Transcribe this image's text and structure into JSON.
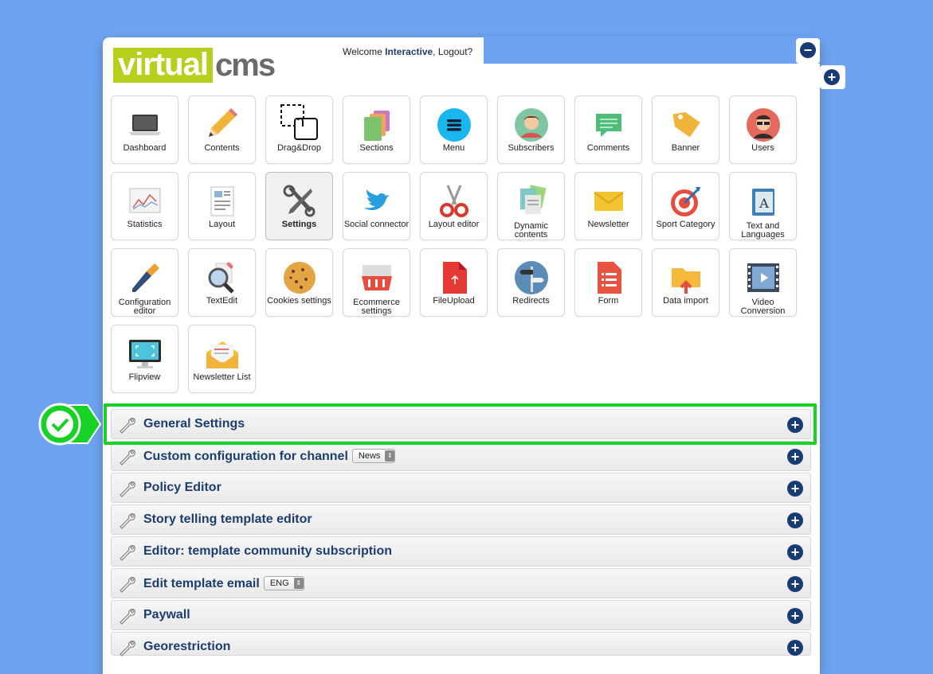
{
  "header": {
    "logo_left": "virtual",
    "logo_right": "cms",
    "welcome_prefix": "Welcome ",
    "user_name": "Interactive",
    "logout_label": ", Logout?"
  },
  "controls": {
    "collapse_icon": "minus-circle-icon",
    "expand_icon": "plus-circle-icon"
  },
  "tiles": [
    {
      "label": "Dashboard",
      "icon": "laptop-icon"
    },
    {
      "label": "Contents",
      "icon": "pencil-icon"
    },
    {
      "label": "Drag&Drop",
      "icon": "drag-drop-icon"
    },
    {
      "label": "Sections",
      "icon": "stacked-cards-icon"
    },
    {
      "label": "Menu",
      "icon": "menu-icon"
    },
    {
      "label": "Subscribers",
      "icon": "person-icon"
    },
    {
      "label": "Comments",
      "icon": "speech-bubble-icon"
    },
    {
      "label": "Banner",
      "icon": "tag-icon"
    },
    {
      "label": "Users",
      "icon": "user-sunglasses-icon"
    },
    {
      "label": "Statistics",
      "icon": "chart-icon"
    },
    {
      "label": "Layout",
      "icon": "document-layout-icon"
    },
    {
      "label": "Settings",
      "icon": "tools-icon",
      "active": true
    },
    {
      "label": "Social connector",
      "icon": "bird-icon"
    },
    {
      "label": "Layout editor",
      "icon": "scissors-icon"
    },
    {
      "label": "Dynamic contents",
      "icon": "documents-icon"
    },
    {
      "label": "Newsletter",
      "icon": "envelope-icon"
    },
    {
      "label": "Sport Category",
      "icon": "target-icon"
    },
    {
      "label": "Text and Languages",
      "icon": "book-icon"
    },
    {
      "label": "Configuration editor",
      "icon": "screwdriver-icon"
    },
    {
      "label": "TextEdit",
      "icon": "magnifier-icon"
    },
    {
      "label": "Cookies settings",
      "icon": "cookie-icon"
    },
    {
      "label": "Ecommerce settings",
      "icon": "basket-icon"
    },
    {
      "label": "FileUpload",
      "icon": "file-upload-icon"
    },
    {
      "label": "Redirects",
      "icon": "signpost-icon"
    },
    {
      "label": "Form",
      "icon": "form-icon"
    },
    {
      "label": "Data import",
      "icon": "folder-import-icon"
    },
    {
      "label": "Video Conversion",
      "icon": "video-icon"
    },
    {
      "label": "Flipview",
      "icon": "monitor-icon"
    },
    {
      "label": "Newsletter List",
      "icon": "open-envelope-icon"
    }
  ],
  "sections": [
    {
      "title": "General Settings"
    },
    {
      "title": "Custom configuration for channel",
      "select": "News"
    },
    {
      "title": "Policy Editor"
    },
    {
      "title": "Story telling template editor"
    },
    {
      "title": "Editor: template community subscription"
    },
    {
      "title": "Edit template email",
      "select": "ENG"
    },
    {
      "title": "Paywall"
    },
    {
      "title": "Georestriction"
    }
  ],
  "colors": {
    "background": "#6da3f0",
    "accent": "#183a75",
    "highlight": "#17d124",
    "logo_green": "#b8cf1e"
  },
  "annotation": {
    "icon": "check-circle-icon",
    "target": "General Settings"
  }
}
